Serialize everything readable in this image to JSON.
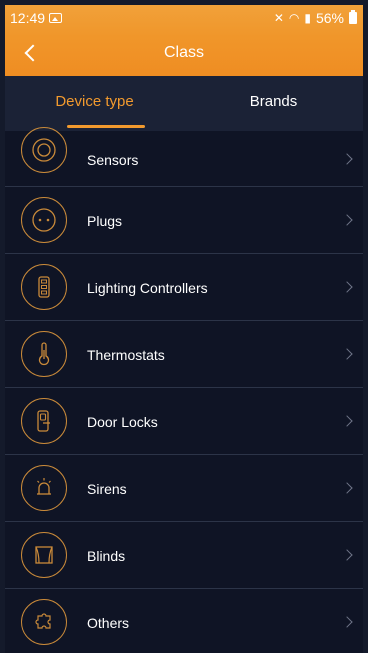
{
  "status_bar": {
    "time": "12:49",
    "battery": "56%"
  },
  "header": {
    "title": "Class"
  },
  "tabs": [
    {
      "label": "Device type",
      "active": true
    },
    {
      "label": "Brands",
      "active": false
    }
  ],
  "items": [
    {
      "label": "Sensors",
      "icon": "sensor-icon"
    },
    {
      "label": "Plugs",
      "icon": "plug-icon"
    },
    {
      "label": "Lighting Controllers",
      "icon": "lighting-controller-icon"
    },
    {
      "label": "Thermostats",
      "icon": "thermostat-icon"
    },
    {
      "label": "Door Locks",
      "icon": "door-lock-icon"
    },
    {
      "label": "Sirens",
      "icon": "siren-icon"
    },
    {
      "label": "Blinds",
      "icon": "blinds-icon"
    },
    {
      "label": "Others",
      "icon": "others-icon"
    }
  ],
  "colors": {
    "accent": "#F29A2E",
    "background": "#0F1425",
    "tab_bar": "#1B2236",
    "divider": "#2C3448"
  }
}
